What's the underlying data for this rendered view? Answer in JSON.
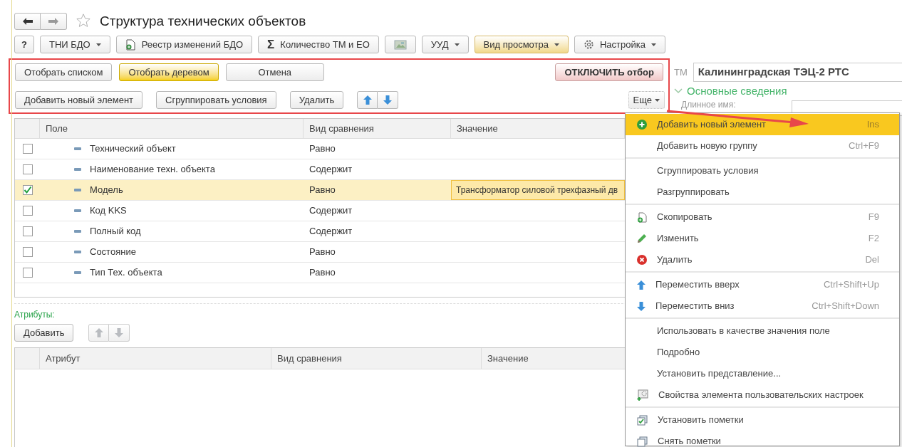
{
  "window": {
    "title": "Структура технических объектов",
    "favorite": false
  },
  "toolbar": [
    {
      "kind": "plain",
      "label": "?",
      "dropdown": false,
      "active": false
    },
    {
      "kind": "plain",
      "label": "ТНИ БДО",
      "dropdown": true,
      "active": false
    },
    {
      "kind": "document",
      "label": "Реестр изменений БДО",
      "dropdown": false,
      "active": false
    },
    {
      "kind": "sigma",
      "symbol": "Σ",
      "label": "Количество ТМ и ЕО",
      "dropdown": false,
      "active": false
    },
    {
      "kind": "image",
      "dropdown": false,
      "active": false
    },
    {
      "kind": "plain",
      "label": "УУД",
      "dropdown": true,
      "active": false
    },
    {
      "kind": "plain",
      "label": "Вид просмотра",
      "dropdown": true,
      "active": true
    },
    {
      "kind": "gear",
      "label": "Настройка",
      "dropdown": true,
      "active": false
    }
  ],
  "filter_panel": {
    "view_buttons": [
      {
        "label": "Отобрать списком",
        "selected": false
      },
      {
        "label": "Отобрать деревом",
        "selected": true
      },
      {
        "label": "Отмена",
        "selected": false
      }
    ],
    "disable_button": "ОТКЛЮЧИТЬ отбор",
    "action_buttons": [
      "Добавить новый элемент",
      "Сгруппировать условия",
      "Удалить"
    ],
    "more_button": "Еще"
  },
  "conditions": {
    "columns": [
      "Поле",
      "Вид сравнения",
      "Значение"
    ],
    "rows": [
      {
        "checked": false,
        "selected": false,
        "field": "Технический объект",
        "comparison": "Равно"
      },
      {
        "checked": false,
        "selected": false,
        "field": "Наименование техн. объекта",
        "comparison": "Содержит"
      },
      {
        "checked": true,
        "selected": true,
        "field": "Модель",
        "comparison": "Равно",
        "value": "Трансформатор силовой трехфазный дв"
      },
      {
        "checked": false,
        "selected": false,
        "field": "Код KKS",
        "comparison": "Содержит"
      },
      {
        "checked": false,
        "selected": false,
        "field": "Полный код",
        "comparison": "Содержит"
      },
      {
        "checked": false,
        "selected": false,
        "field": "Состояние",
        "comparison": "Равно"
      },
      {
        "checked": false,
        "selected": false,
        "field": "Тип Тех. объекта",
        "comparison": "Равно"
      }
    ]
  },
  "attributes": {
    "label": "Атрибуты:",
    "add_button": "Добавить",
    "move_disabled": true,
    "columns": [
      "Атрибут",
      "Вид сравнения",
      "Значение"
    ]
  },
  "details": {
    "label": "ТМ",
    "value": "Калининградская ТЭЦ-2 РТС",
    "section": {
      "title": "Основные сведения",
      "expanded": true
    },
    "field_label": "Длинное имя:"
  },
  "context_menu": [
    [
      {
        "kind": "add",
        "label": "Добавить новый элемент",
        "shortcut": "Ins",
        "selected": true
      },
      {
        "kind": "plain",
        "label": "Добавить новую группу",
        "shortcut": "Ctrl+F9",
        "selected": false
      }
    ],
    [
      {
        "kind": "plain",
        "label": "Сгруппировать условия",
        "selected": false
      },
      {
        "kind": "plain",
        "label": "Разгруппировать",
        "selected": false
      }
    ],
    [
      {
        "kind": "copy",
        "label": "Скопировать",
        "shortcut": "F9",
        "selected": false
      },
      {
        "kind": "edit",
        "label": "Изменить",
        "shortcut": "F2",
        "selected": false
      },
      {
        "kind": "delete",
        "label": "Удалить",
        "shortcut": "Del",
        "selected": false
      }
    ],
    [
      {
        "kind": "up",
        "label": "Переместить вверх",
        "shortcut": "Ctrl+Shift+Up",
        "selected": false
      },
      {
        "kind": "down",
        "label": "Переместить вниз",
        "shortcut": "Ctrl+Shift+Down",
        "selected": false
      }
    ],
    [
      {
        "kind": "plain",
        "label": "Использовать в качестве значения поле",
        "selected": false
      },
      {
        "kind": "plain",
        "label": "Подробно",
        "selected": false
      },
      {
        "kind": "plain",
        "label": "Установить представление...",
        "selected": false
      },
      {
        "kind": "settings",
        "label": "Свойства элемента пользовательских настроек",
        "selected": false
      }
    ],
    [
      {
        "kind": "mark",
        "label": "Установить пометки",
        "selected": false
      },
      {
        "kind": "unmark",
        "label": "Снять пометки",
        "selected": false
      }
    ]
  ]
}
